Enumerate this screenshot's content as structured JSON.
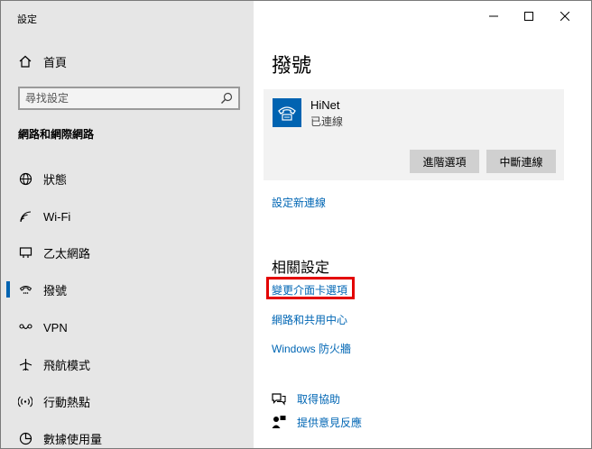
{
  "window": {
    "title": "設定"
  },
  "sidebar": {
    "home_label": "首頁",
    "search_placeholder": "尋找設定",
    "section_heading": "網路和網際網路",
    "items": [
      {
        "label": "狀態",
        "icon": "globe-icon"
      },
      {
        "label": "Wi-Fi",
        "icon": "wifi-icon"
      },
      {
        "label": "乙太網路",
        "icon": "ethernet-icon"
      },
      {
        "label": "撥號",
        "icon": "dialup-icon",
        "active": true
      },
      {
        "label": "VPN",
        "icon": "vpn-icon"
      },
      {
        "label": "飛航模式",
        "icon": "airplane-icon"
      },
      {
        "label": "行動熱點",
        "icon": "hotspot-icon"
      },
      {
        "label": "數據使用量",
        "icon": "data-usage-icon"
      }
    ]
  },
  "main": {
    "title": "撥號",
    "connection": {
      "name": "HiNet",
      "status": "已連線",
      "advanced_button": "進階選項",
      "disconnect_button": "中斷連線"
    },
    "setup_link": "設定新連線",
    "related_heading": "相關設定",
    "related_links": {
      "adapter_options": "變更介面卡選項",
      "sharing_center": "網路和共用中心",
      "firewall": "Windows 防火牆"
    },
    "help": {
      "get_help": "取得協助",
      "feedback": "提供意見反應"
    }
  },
  "colors": {
    "accent": "#0063b1",
    "link": "#0066b4",
    "highlight": "#e30000",
    "sidebar_bg": "#e6e6e6"
  }
}
